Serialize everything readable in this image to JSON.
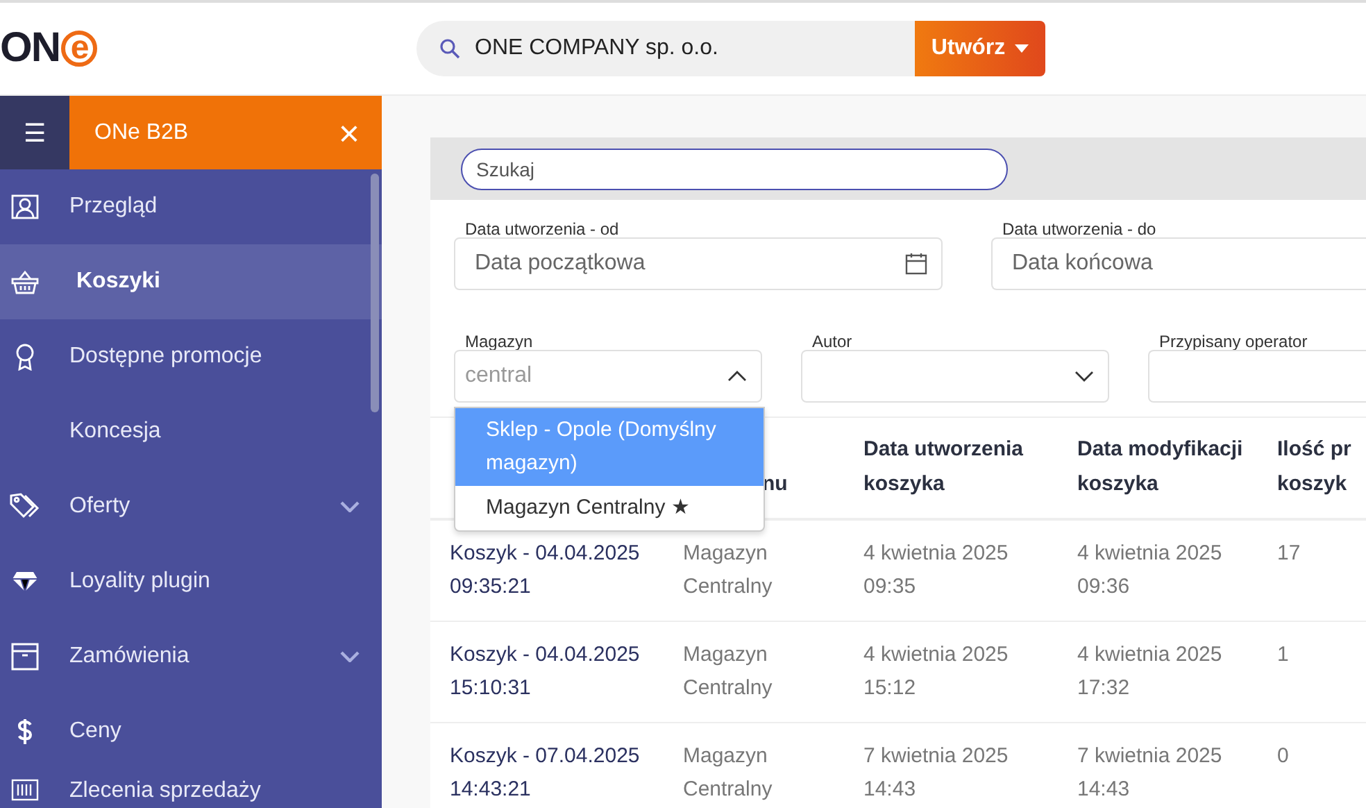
{
  "logo": {
    "text": "ON",
    "accent": "e"
  },
  "company_search": {
    "value": "ONE COMPANY sp. o.o."
  },
  "create_button": {
    "label": "Utwórz"
  },
  "sidebar": {
    "menu_icon": "☰",
    "title": "ONe B2B",
    "close": "×",
    "items": [
      {
        "label": "Przegląd",
        "selected": false,
        "expandable": false
      },
      {
        "label": "Koszyki",
        "selected": true,
        "expandable": false
      },
      {
        "label": "Dostępne promocje",
        "selected": false,
        "expandable": false
      },
      {
        "label": "Koncesja",
        "selected": false,
        "expandable": false
      },
      {
        "label": "Oferty",
        "selected": false,
        "expandable": true
      },
      {
        "label": "Loyality plugin",
        "selected": false,
        "expandable": false
      },
      {
        "label": "Zamówienia",
        "selected": false,
        "expandable": true
      },
      {
        "label": "Ceny",
        "selected": false,
        "expandable": false
      },
      {
        "label": "Zlecenia sprzedaży",
        "selected": false,
        "expandable": false
      }
    ]
  },
  "search": {
    "placeholder": "Szukaj"
  },
  "filters": {
    "date_from": {
      "label": "Data utworzenia - od",
      "placeholder": "Data początkowa"
    },
    "date_to": {
      "label": "Data utworzenia - do",
      "placeholder": "Data końcowa"
    },
    "warehouse": {
      "label": "Magazyn",
      "value": "central",
      "expanded": true,
      "options": [
        {
          "label": "Sklep - Opole (Domyślny magazyn)",
          "selected": true
        },
        {
          "label": "Magazyn Centralny ★",
          "selected": false
        }
      ]
    },
    "author": {
      "label": "Autor"
    },
    "operator": {
      "label": "Przypisany operator"
    }
  },
  "table": {
    "columns": [
      "",
      "nu",
      "Data utworzenia koszyka",
      "Data modyfikacji koszyka",
      "Ilość pr koszyk"
    ],
    "rows": [
      [
        "Koszyk - 04.04.2025 09:35:21",
        "Magazyn Centralny",
        "4 kwietnia 2025 09:35",
        "4 kwietnia 2025 09:36",
        "17"
      ],
      [
        "Koszyk - 04.04.2025 15:10:31",
        "Magazyn Centralny",
        "4 kwietnia 2025 15:12",
        "4 kwietnia 2025 17:32",
        "1"
      ],
      [
        "Koszyk - 07.04.2025 14:43:21",
        "Magazyn Centralny",
        "7 kwietnia 2025 14:43",
        "7 kwietnia 2025 14:43",
        "0"
      ]
    ]
  }
}
